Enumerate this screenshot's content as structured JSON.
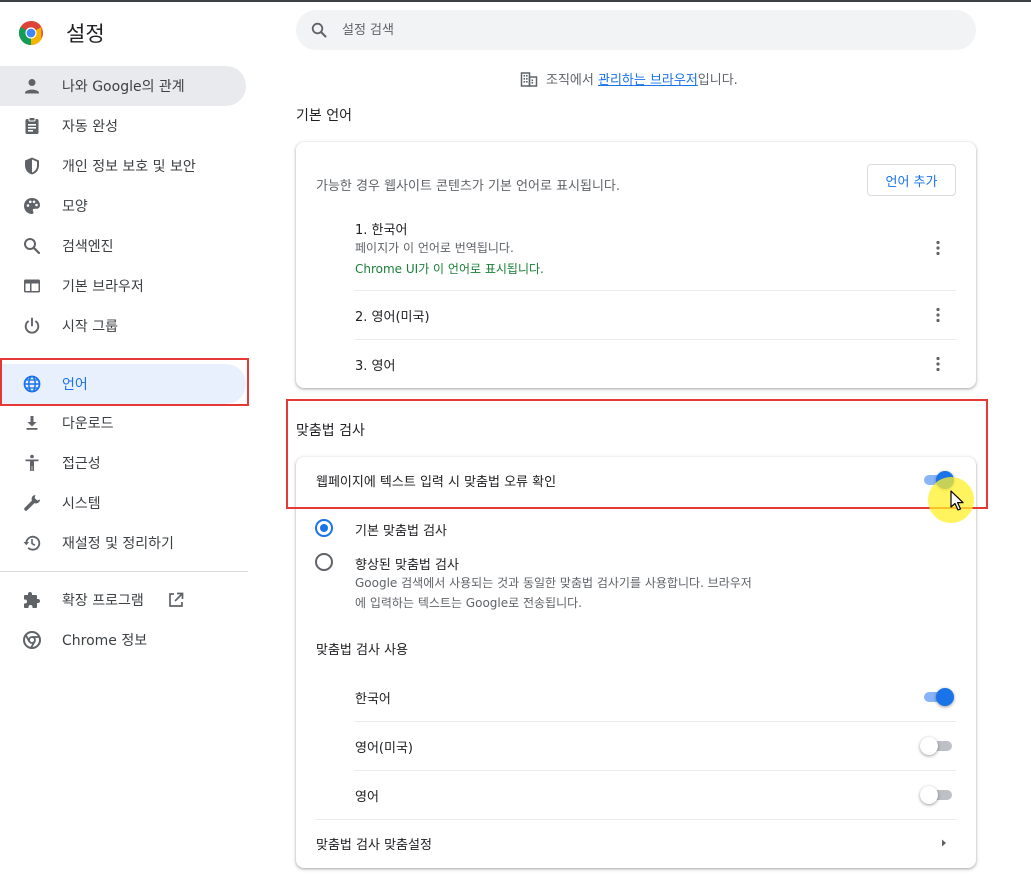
{
  "app": {
    "title": "설정",
    "accent_color": "#1a73e8",
    "highlight_color": "#e53935"
  },
  "search": {
    "placeholder": "설정 검색",
    "value": ""
  },
  "sidebar": {
    "items": [
      {
        "label": "나와 Google의 관계",
        "icon": "person-icon"
      },
      {
        "label": "자동 완성",
        "icon": "clipboard-icon"
      },
      {
        "label": "개인 정보 보호 및 보안",
        "icon": "shield-icon"
      },
      {
        "label": "모양",
        "icon": "palette-icon"
      },
      {
        "label": "검색엔진",
        "icon": "search-icon"
      },
      {
        "label": "기본 브라우저",
        "icon": "browser-window-icon"
      },
      {
        "label": "시작 그룹",
        "icon": "power-icon"
      },
      {
        "label": "언어",
        "icon": "globe-icon",
        "selected": true
      },
      {
        "label": "다운로드",
        "icon": "download-icon"
      },
      {
        "label": "접근성",
        "icon": "accessibility-icon"
      },
      {
        "label": "시스템",
        "icon": "wrench-icon"
      },
      {
        "label": "재설정 및 정리하기",
        "icon": "restore-icon"
      }
    ],
    "extensions": {
      "label": "확장 프로그램",
      "icon": "puzzle-icon",
      "external_icon": "open-external-icon"
    },
    "about": {
      "label": "Chrome 정보",
      "icon": "chrome-icon"
    }
  },
  "managed_notice": {
    "prefix": "조직에서 ",
    "link": "관리하는 브라우저",
    "suffix": "입니다.",
    "icon": "building-icon"
  },
  "languages": {
    "section_title": "기본 언어",
    "description": "가능한 경우 웹사이트 콘텐츠가 기본 언어로 표시됩니다.",
    "add_button": "언어 추가",
    "list": [
      {
        "label": "1. 한국어",
        "note": "페이지가 이 언어로 번역됩니다.",
        "ui_note": "Chrome UI가 이 언어로 표시됩니다."
      },
      {
        "label": "2. 영어(미국)"
      },
      {
        "label": "3. 영어"
      }
    ]
  },
  "spellcheck": {
    "section_title": "맞춤법 검사",
    "toggle_label": "웹페이지에 텍스트 입력 시 맞춤법 오류 확인",
    "toggle_on": true,
    "basic_label": "기본 맞춤법 검사",
    "basic_selected": true,
    "enhanced_label": "향상된 맞춤법 검사",
    "enhanced_desc_line1": "Google 검색에서 사용되는 것과 동일한 맞춤법 검사기를 사용합니다. 브라우저",
    "enhanced_desc_line2": "에 입력하는 텍스트는 Google로 전송됩니다.",
    "use_title": "맞춤법 검사 사용",
    "use_languages": [
      {
        "label": "한국어",
        "on": true
      },
      {
        "label": "영어(미국)",
        "on": false
      },
      {
        "label": "영어",
        "on": false
      }
    ],
    "customize_label": "맞춤법 검사 맞춤설정"
  }
}
